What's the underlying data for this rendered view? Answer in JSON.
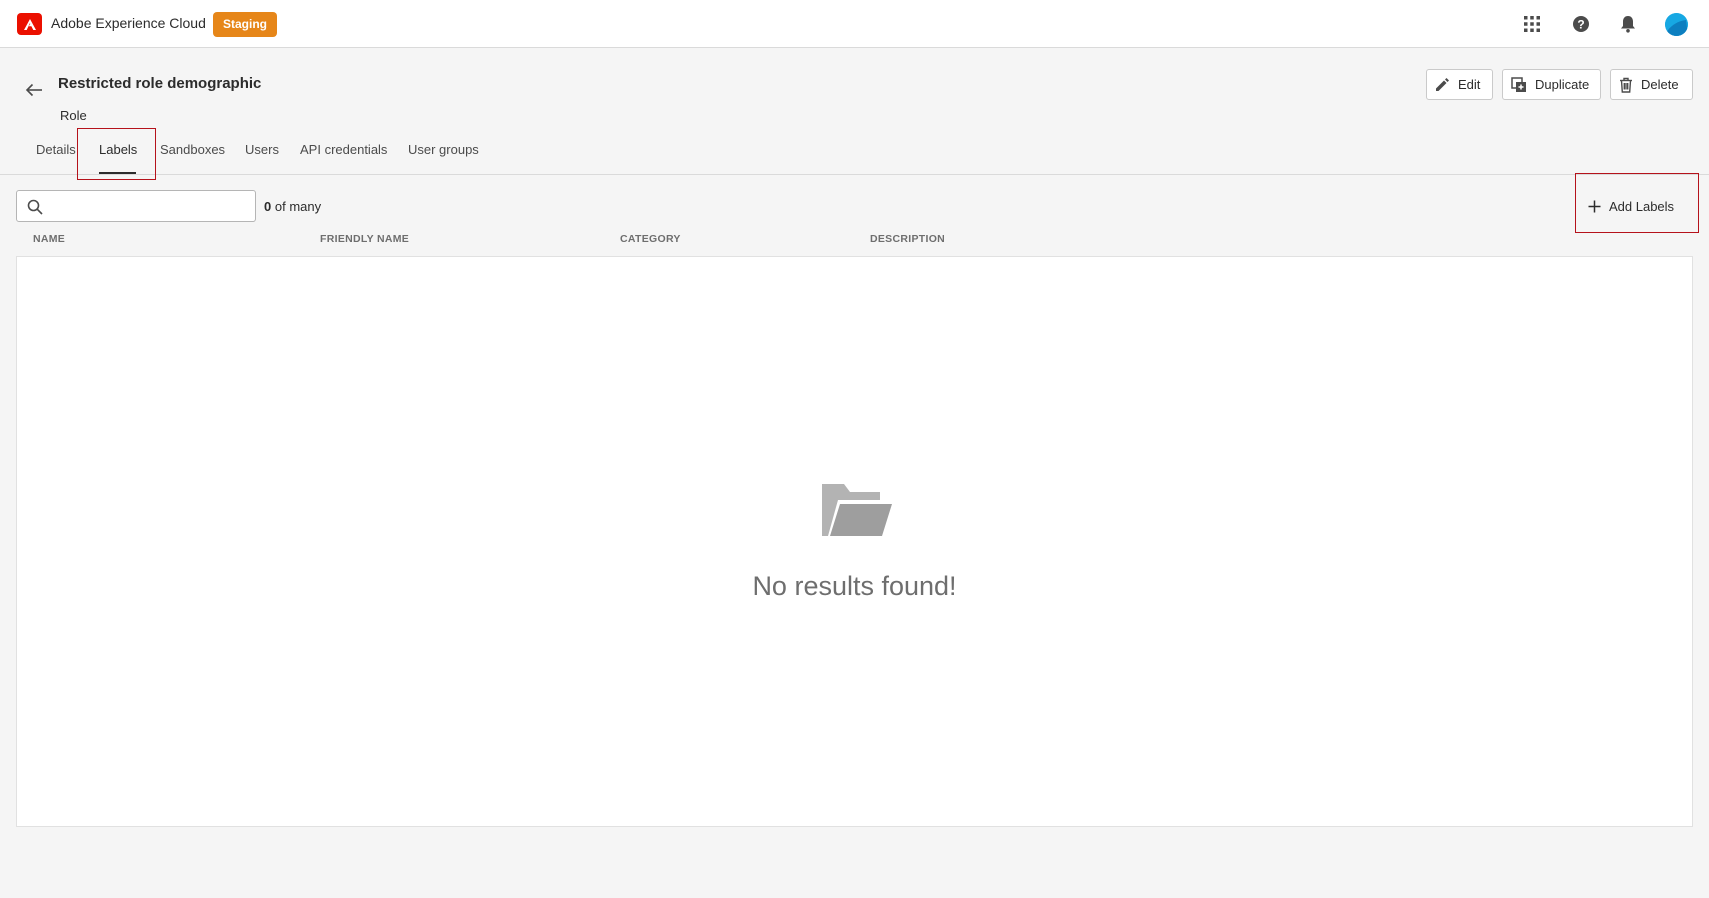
{
  "app": {
    "name": "Adobe Experience Cloud",
    "environment_badge": "Staging",
    "icons": [
      "apps-grid-icon",
      "help-icon",
      "bell-icon",
      "avatar"
    ]
  },
  "header": {
    "title": "Restricted role demographic",
    "subtitle": "Role",
    "actions": {
      "edit_label": "Edit",
      "duplicate_label": "Duplicate",
      "delete_label": "Delete"
    }
  },
  "tabs": [
    {
      "label": "Details",
      "active": false
    },
    {
      "label": "Labels",
      "active": true
    },
    {
      "label": "Sandboxes",
      "active": false
    },
    {
      "label": "Users",
      "active": false
    },
    {
      "label": "API credentials",
      "active": false
    },
    {
      "label": "User groups",
      "active": false
    }
  ],
  "toolbar": {
    "search_value": "",
    "count_number": "0",
    "count_suffix": "of many",
    "add_labels_label": "Add Labels"
  },
  "table": {
    "columns": [
      "NAME",
      "FRIENDLY NAME",
      "CATEGORY",
      "DESCRIPTION"
    ],
    "rows": [],
    "empty_message": "No results found!"
  },
  "colors": {
    "brand": "#eb1000",
    "staging_badge": "#e68619",
    "highlight": "#b5121b",
    "avatar": "#17a8e3"
  }
}
